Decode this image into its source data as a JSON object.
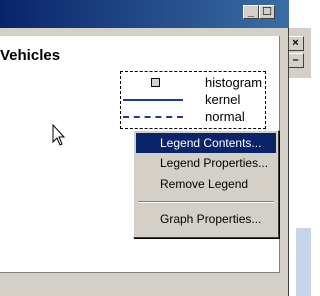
{
  "window": {
    "title": "",
    "controls": {
      "minimize_glyph": "_",
      "maximize_glyph": "☐"
    }
  },
  "background_window": {
    "close_glyph": "×",
    "minimize_glyph": "–"
  },
  "graph": {
    "title": "Vehicles",
    "legend": {
      "entries": [
        {
          "label": "histogram",
          "symbol": "square-icon"
        },
        {
          "label": "kernel",
          "symbol": "solid-line"
        },
        {
          "label": "normal",
          "symbol": "dashed-line"
        }
      ]
    }
  },
  "context_menu": {
    "items": [
      {
        "label": "Legend Contents...",
        "selected": true
      },
      {
        "label": "Legend Properties...",
        "selected": false
      },
      {
        "label": "Remove Legend",
        "selected": false
      },
      {
        "separator": true
      },
      {
        "label": "Graph Properties...",
        "selected": false
      }
    ]
  },
  "colors": {
    "titlebar": "#0a246a",
    "menu_highlight": "#0a246a",
    "line_color": "#1f3a93",
    "chrome": "#d4d0c8"
  }
}
